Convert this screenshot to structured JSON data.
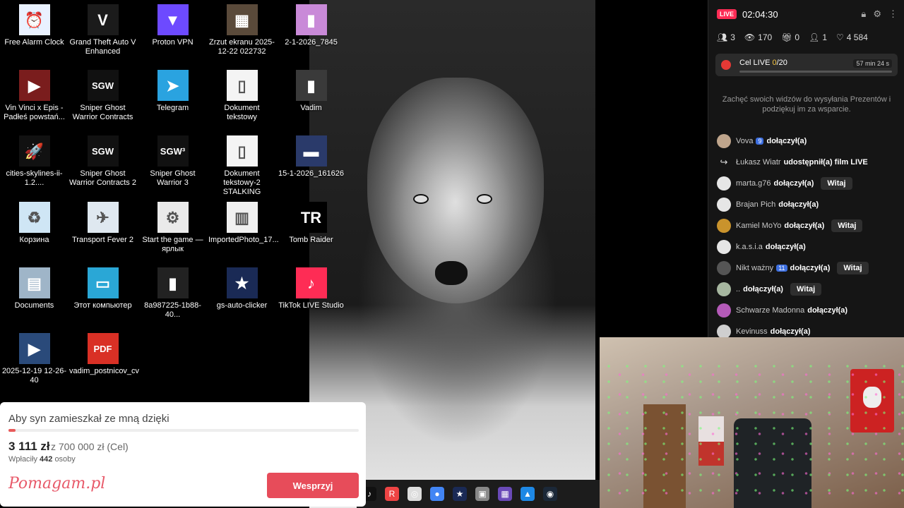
{
  "desktop": {
    "icons": [
      {
        "label": "Free Alarm Clock",
        "glyph": "⏰",
        "bg": "#e9f1ff"
      },
      {
        "label": "Grand Theft Auto V Enhanced",
        "glyph": "V",
        "bg": "#1b1b1b"
      },
      {
        "label": "Proton VPN",
        "glyph": "▼",
        "bg": "#6d4aff"
      },
      {
        "label": "Zrzut ekranu 2025-12-22 022732",
        "glyph": "▦",
        "bg": "#5a4a3a"
      },
      {
        "label": "2-1-2026_7845",
        "glyph": "▮",
        "bg": "#c98ad8"
      },
      {
        "label": "Vin Vinci x Epis - Padłeś powstań...",
        "glyph": "▶",
        "bg": "#7a1d1d"
      },
      {
        "label": "Sniper Ghost Warrior Contracts",
        "glyph": "SGW",
        "bg": "#111"
      },
      {
        "label": "Telegram",
        "glyph": "➤",
        "bg": "#2aa3e0"
      },
      {
        "label": "Dokument tekstowy",
        "glyph": "▯",
        "bg": "#f4f4f4"
      },
      {
        "label": "Vadim",
        "glyph": "▮",
        "bg": "#3a3a3a"
      },
      {
        "label": "cities-skylines-ii-1.2....",
        "glyph": "🚀",
        "bg": "#111"
      },
      {
        "label": "Sniper Ghost Warrior Contracts 2",
        "glyph": "SGW",
        "bg": "#111"
      },
      {
        "label": "Sniper Ghost Warrior 3",
        "glyph": "SGW³",
        "bg": "#111"
      },
      {
        "label": "Dokument tekstowy-2 STALKING",
        "glyph": "▯",
        "bg": "#f4f4f4"
      },
      {
        "label": "15-1-2026_161626",
        "glyph": "▬",
        "bg": "#2a3a6a"
      },
      {
        "label": "Корзина",
        "glyph": "♻",
        "bg": "#cfe6f5"
      },
      {
        "label": "Transport Fever 2",
        "glyph": "✈",
        "bg": "#dfe8f0"
      },
      {
        "label": "Start the game — ярлык",
        "glyph": "⚙",
        "bg": "#eaeaea"
      },
      {
        "label": "ImportedPhoto_17...",
        "glyph": "▥",
        "bg": "#f0f0f0"
      },
      {
        "label": "Tomb Raider",
        "glyph": "TR",
        "bg": "#000"
      },
      {
        "label": "Documents",
        "glyph": "▤",
        "bg": "#9fb5c8"
      },
      {
        "label": "Этот компьютер",
        "glyph": "▭",
        "bg": "#2aa7d6"
      },
      {
        "label": "8a987225-1b88-40...",
        "glyph": "▮",
        "bg": "#222"
      },
      {
        "label": "gs-auto-clicker",
        "glyph": "★",
        "bg": "#1a2a55"
      },
      {
        "label": "TikTok LIVE Studio",
        "glyph": "♪",
        "bg": "#fe2c55"
      },
      {
        "label": "2025-12-19 12-26-40",
        "glyph": "▶",
        "bg": "#2a4a7a"
      },
      {
        "label": "vadim_postnicov_cv",
        "glyph": "PDF",
        "bg": "#d93025"
      }
    ]
  },
  "live": {
    "badge": "LIVE",
    "timer": "02:04:30",
    "stats": {
      "viewers_now": "3",
      "views": "170",
      "gifts": "0",
      "new_followers": "1",
      "likes": "4 584"
    },
    "goal": {
      "label": "Cel LIVE",
      "current": "0",
      "target": "/20",
      "time_left": "57 min 24 s"
    },
    "hint": "Zachęć swoich widzów do wysyłania Prezentów i podziękuj im za wsparcie.",
    "witaj_label": "Witaj",
    "feed": [
      {
        "user": "Vova",
        "level": "9",
        "action": "dołączył(a)",
        "witaj": false,
        "avatar": "#bfa58c"
      },
      {
        "user": "Łukasz Wiatr",
        "level": "",
        "action": "udostępnił(a) film LIVE",
        "witaj": false,
        "avatar": "share"
      },
      {
        "user": "marta.g76",
        "level": "",
        "action": "dołączył(a)",
        "witaj": true,
        "avatar": "#e6e6e6"
      },
      {
        "user": "Brajan Pich",
        "level": "",
        "action": "dołączył(a)",
        "witaj": false,
        "avatar": "#e6e6e6"
      },
      {
        "user": "Kamiel MoYo",
        "level": "",
        "action": "dołączył(a)",
        "witaj": true,
        "avatar": "#c9932c"
      },
      {
        "user": "k.a.s.i.a",
        "level": "",
        "action": "dołączył(a)",
        "witaj": false,
        "avatar": "#e6e6e6"
      },
      {
        "user": "Nikt ważny",
        "level": "11",
        "action": "dołączył(a)",
        "witaj": true,
        "avatar": "#555"
      },
      {
        "user": "..",
        "level": "",
        "action": "dołączył(a)",
        "witaj": true,
        "avatar": "#a7b7a0"
      },
      {
        "user": "Schwarze Madonna",
        "level": "",
        "action": "dołączył(a)",
        "witaj": false,
        "avatar": "#b45ab8"
      },
      {
        "user": "Kevinuss",
        "level": "",
        "action": "dołączył(a)",
        "witaj": false,
        "avatar": "#cfcfcf"
      }
    ]
  },
  "fundraiser": {
    "title": "Aby syn zamieszkał ze mną dzięki",
    "progress_fraction": 0.0044,
    "amount": "3 111 zł",
    "goal_text": "z 700 000 zł (Cel)",
    "donors_prefix": "Wpłaciły",
    "donors_count": "442",
    "donors_suffix": "osoby",
    "logo": "Pomagam.pl",
    "button": "Wesprzyj"
  },
  "taskbar": {
    "icons": [
      {
        "name": "tiktok-taskbar-icon",
        "glyph": "♪",
        "bg": "#111"
      },
      {
        "name": "rockstar-taskbar-icon",
        "glyph": "R",
        "bg": "#e44"
      },
      {
        "name": "unknown-app-taskbar-icon",
        "glyph": "◎",
        "bg": "#ddd"
      },
      {
        "name": "chrome-taskbar-icon",
        "glyph": "●",
        "bg": "#4285f4"
      },
      {
        "name": "star-app-taskbar-icon",
        "glyph": "★",
        "bg": "#1a2a55"
      },
      {
        "name": "box-app-taskbar-icon",
        "glyph": "▣",
        "bg": "#888"
      },
      {
        "name": "puzzle-app-taskbar-icon",
        "glyph": "▦",
        "bg": "#6a4ab8"
      },
      {
        "name": "photos-taskbar-icon",
        "glyph": "▲",
        "bg": "#1e88e5"
      },
      {
        "name": "steam-taskbar-icon",
        "glyph": "◉",
        "bg": "#1b2838"
      }
    ]
  }
}
